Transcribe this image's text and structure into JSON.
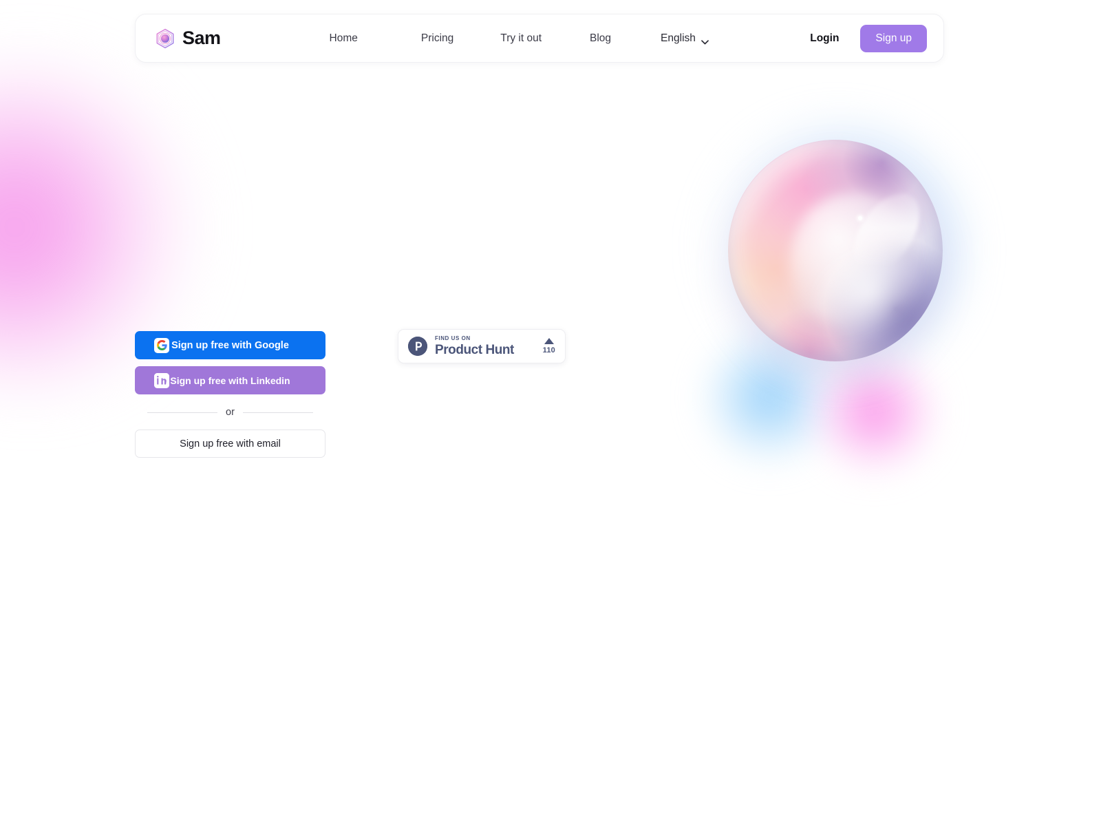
{
  "brand": {
    "name": "Sam",
    "logo_icon": "hexagon-gradient-orb-icon"
  },
  "header": {
    "nav": [
      {
        "label": "Home",
        "name": "nav-item-home"
      },
      {
        "label": "Pricing",
        "name": "nav-item-pricing"
      },
      {
        "label": "Try it out",
        "name": "nav-item-try-it-out"
      },
      {
        "label": "Blog",
        "name": "nav-item-blog"
      }
    ],
    "language": {
      "selected": "English",
      "chevron_icon": "chevron-down-icon"
    },
    "login_label": "Login",
    "signup_label": "Sign up"
  },
  "auth": {
    "google_label": "Sign up free with Google",
    "google_icon": "google-g-icon",
    "linkedin_label": "Sign up free with Linkedin",
    "linkedin_icon": "linkedin-in-icon",
    "divider_label": "or",
    "email_label": "Sign up free with email"
  },
  "product_hunt": {
    "kicker": "FIND US ON",
    "title": "Product Hunt",
    "logo_icon": "product-hunt-p-icon",
    "upvote_icon": "triangle-up-icon",
    "upvote_count": "110"
  },
  "colors": {
    "accent_purple": "#a07ae8",
    "google_blue": "#0b72f0",
    "linkedin_purple": "#a077d9",
    "product_hunt_slate": "#4b5579",
    "page_background": "#ffffff",
    "text_primary": "#1b1b25"
  },
  "decoration": {
    "sphere": "iridescent-glass-sphere",
    "orb_blue": "blurred-blue-orb",
    "orb_pink": "blurred-pink-orb",
    "blob_left": "blurred-pink-blob"
  }
}
